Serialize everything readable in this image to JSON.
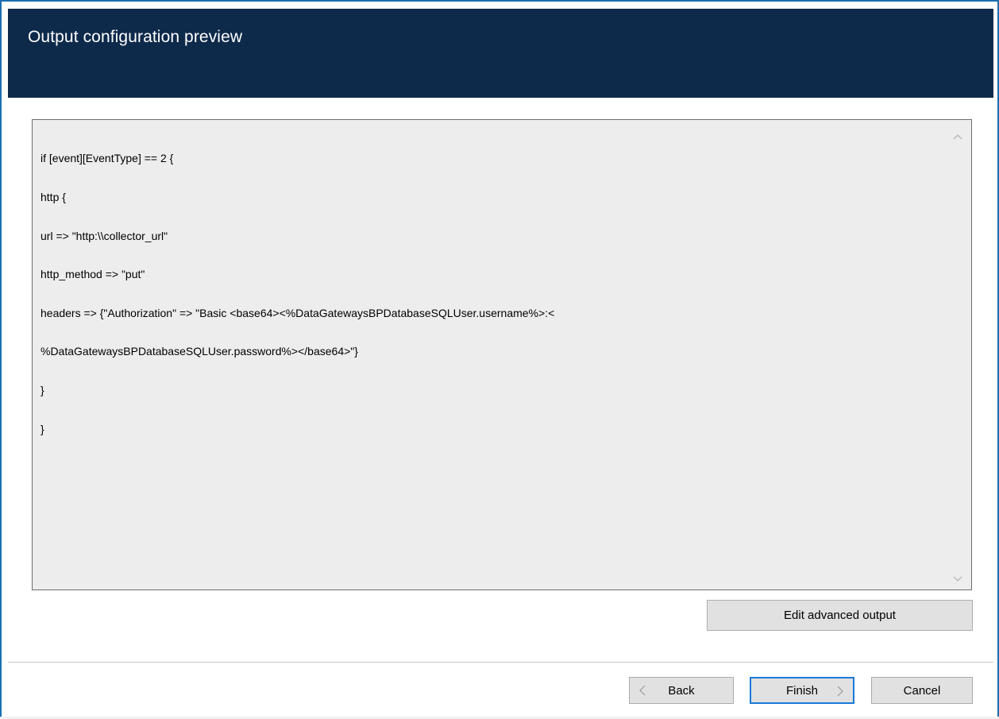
{
  "header": {
    "title": "Output configuration preview"
  },
  "code": {
    "lines": [
      "if [event][EventType] == 2 {",
      "http {",
      "url => \"http:\\\\collector_url\"",
      "http_method => \"put\"",
      "headers => {\"Authorization\" => \"Basic <base64><%DataGatewaysBPDatabaseSQLUser.username%>:<",
      "%DataGatewaysBPDatabaseSQLUser.password%></base64>\"}",
      "}",
      "}"
    ]
  },
  "buttons": {
    "edit_advanced": "Edit advanced output",
    "back": "Back",
    "finish": "Finish",
    "cancel": "Cancel"
  },
  "colors": {
    "header_bg": "#0e2a4b",
    "window_border": "#1a6fb0",
    "default_button_border": "#1a7bd6"
  },
  "icons": {
    "scroll_up": "chevron-up-icon",
    "scroll_down": "chevron-down-icon",
    "back": "chevron-left-icon",
    "finish": "chevron-right-icon"
  }
}
